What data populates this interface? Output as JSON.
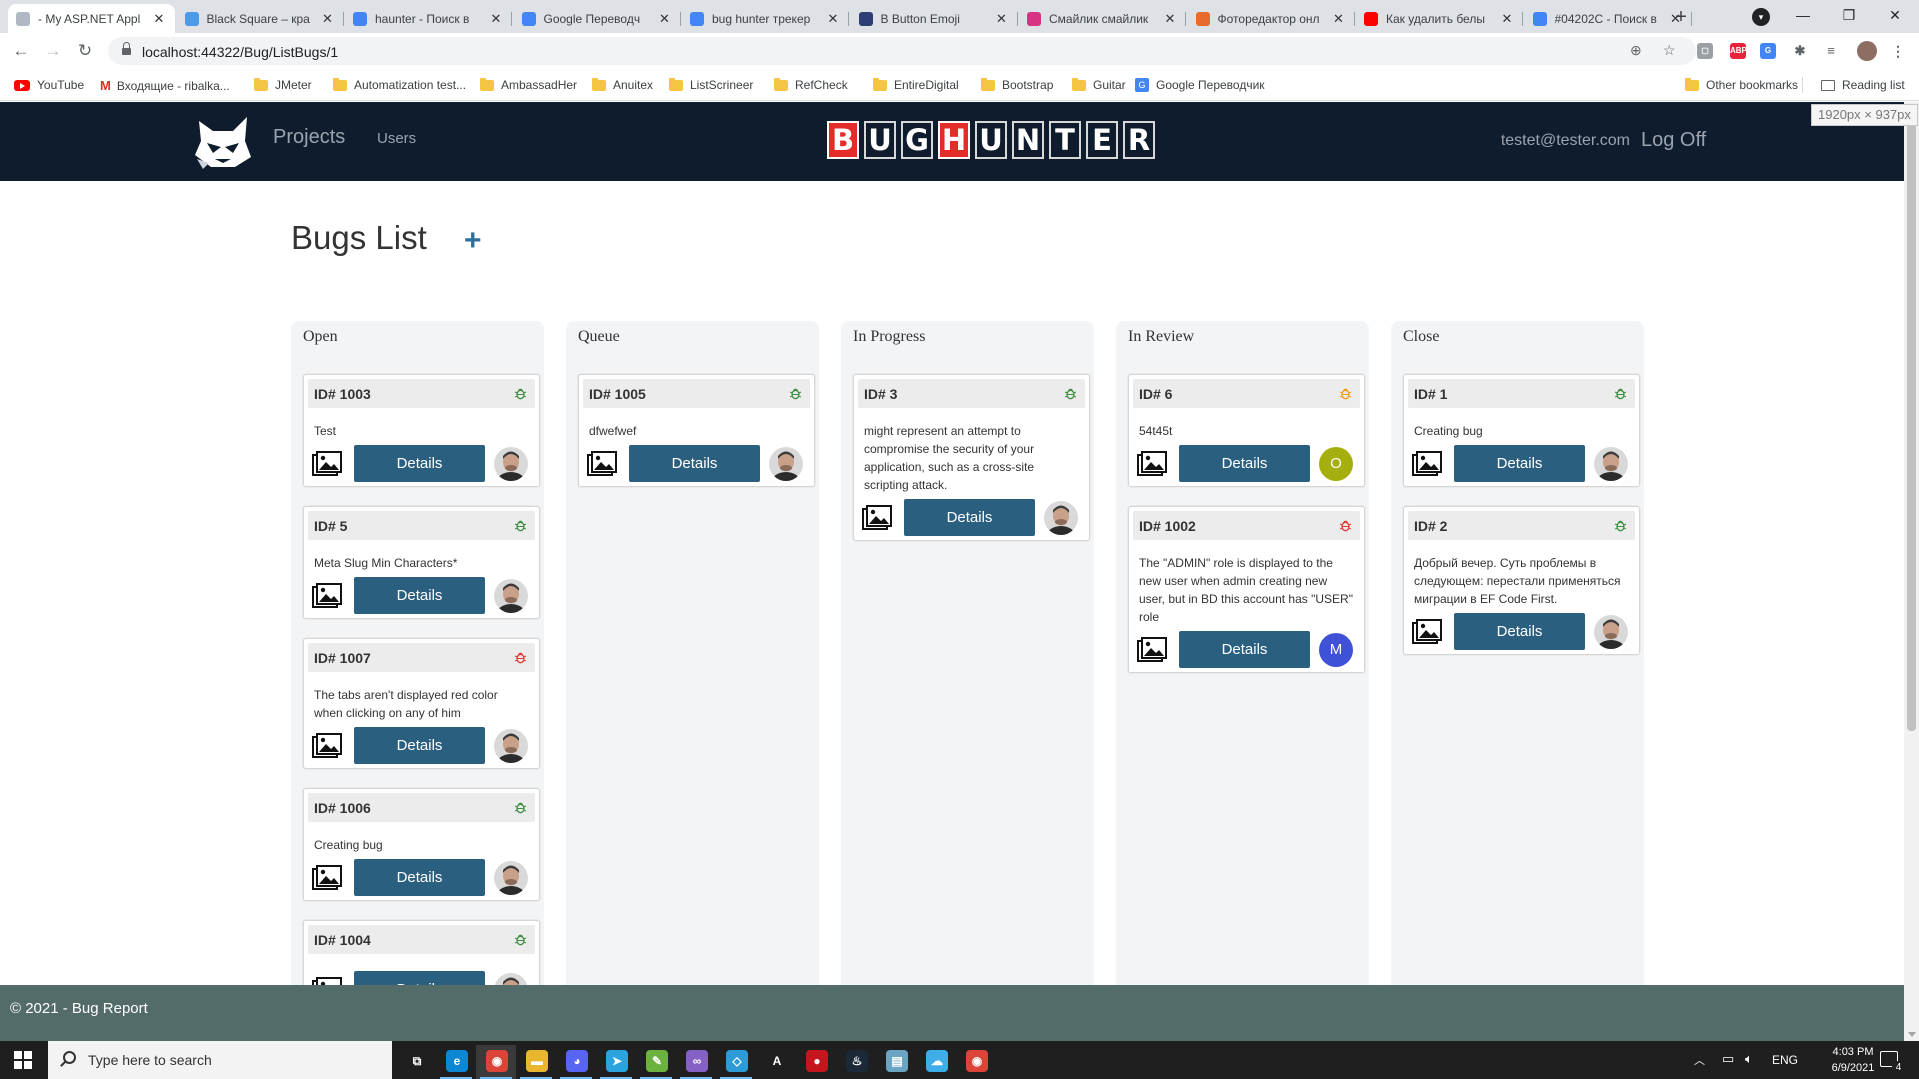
{
  "browser": {
    "tabs": [
      {
        "title": "- My ASP.NET Appl",
        "color": "#b0b8c4",
        "active": true
      },
      {
        "title": "Black Square – кра",
        "color": "#4b9be8",
        "active": false
      },
      {
        "title": "haunter - Поиск в",
        "color": "#4285f4",
        "active": false
      },
      {
        "title": "Google Переводч",
        "color": "#4285f4",
        "active": false
      },
      {
        "title": "bug hunter трекер",
        "color": "#4285f4",
        "active": false
      },
      {
        "title": "B Button Emoji",
        "color": "#2c3e75",
        "active": false
      },
      {
        "title": "Смайлик смайлик",
        "color": "#d63384",
        "active": false
      },
      {
        "title": "Фоторедактор онл",
        "color": "#e86a2c",
        "active": false
      },
      {
        "title": "Как удалить белы",
        "color": "#ff0000",
        "active": false
      },
      {
        "title": "#04202C - Поиск в",
        "color": "#4285f4",
        "active": false
      }
    ],
    "url": "localhost:44322/Bug/ListBugs/1",
    "bookmarks": [
      {
        "label": "YouTube",
        "icon": "youtube-icon"
      },
      {
        "label": "Входящие - ribalka...",
        "icon": "gmail-icon"
      },
      {
        "label": "JMeter",
        "icon": "folder-icon"
      },
      {
        "label": "Automatization test...",
        "icon": "folder-icon"
      },
      {
        "label": "AmbassadHer",
        "icon": "folder-icon"
      },
      {
        "label": "Anuitex",
        "icon": "folder-icon"
      },
      {
        "label": "ListScrineer",
        "icon": "folder-icon"
      },
      {
        "label": "RefCheck",
        "icon": "folder-icon"
      },
      {
        "label": "EntireDigital",
        "icon": "folder-icon"
      },
      {
        "label": "Bootstrap",
        "icon": "folder-icon"
      },
      {
        "label": "Guitar",
        "icon": "folder-icon"
      },
      {
        "label": "Google Переводчик",
        "icon": "translate-icon"
      }
    ],
    "other_bookmarks": "Other bookmarks",
    "reading_list": "Reading list",
    "viewport_tip": "1920px × 937px"
  },
  "navbar": {
    "projects": "Projects",
    "users": "Users",
    "brand_letters": [
      "B",
      "U",
      "G",
      "H",
      "U",
      "N",
      "T",
      "E",
      "R"
    ],
    "user_email": "testet@tester.com",
    "logoff": "Log Off"
  },
  "page": {
    "title": "Bugs List",
    "add_symbol": "+"
  },
  "columns": [
    {
      "name": "Open",
      "cards": [
        {
          "id": "ID# 1003",
          "desc": "Test",
          "priority": "green",
          "avatar": "photo"
        },
        {
          "id": "ID# 5",
          "desc": "Meta Slug Min Characters*",
          "priority": "green",
          "avatar": "photo"
        },
        {
          "id": "ID# 1007",
          "desc": "The tabs aren't displayed red color when clicking on any of him",
          "priority": "red",
          "avatar": "photo"
        },
        {
          "id": "ID# 1006",
          "desc": "Creating bug",
          "priority": "green",
          "avatar": "photo"
        },
        {
          "id": "ID# 1004",
          "desc": "",
          "priority": "green",
          "avatar": "photo"
        }
      ]
    },
    {
      "name": "Queue",
      "cards": [
        {
          "id": "ID# 1005",
          "desc": "dfwefwef",
          "priority": "green",
          "avatar": "photo"
        }
      ]
    },
    {
      "name": "In Progress",
      "cards": [
        {
          "id": "ID# 3",
          "desc": "might represent an attempt to compromise the security of your application, such as a cross-site scripting attack.",
          "priority": "green",
          "avatar": "photo"
        }
      ]
    },
    {
      "name": "In Review",
      "cards": [
        {
          "id": "ID# 6",
          "desc": "54t45t",
          "priority": "orange",
          "avatar": "O",
          "avatar_color": "#a5b00e"
        },
        {
          "id": "ID# 1002",
          "desc": "The \"ADMIN\" role is displayed to the new user when admin creating new user, but in BD this account has \"USER\" role",
          "priority": "red",
          "avatar": "M",
          "avatar_color": "#3f51d6"
        }
      ]
    },
    {
      "name": "Close",
      "cards": [
        {
          "id": "ID# 1",
          "desc": "Creating bug",
          "priority": "green",
          "avatar": "photo"
        },
        {
          "id": "ID# 2",
          "desc": "Добрый вечер. Суть проблемы в следующем: перестали применяться миграции в EF Code First.",
          "priority": "green",
          "avatar": "photo"
        }
      ]
    }
  ],
  "details_label": "Details",
  "priority_colors": {
    "green": "#3e8e41",
    "red": "#e53935",
    "orange": "#f39c12"
  },
  "footer": "© 2021 - Bug Report",
  "taskbar": {
    "search_placeholder": "Type here to search",
    "lang": "ENG",
    "time": "4:03 PM",
    "date": "6/9/2021",
    "notifications": "4"
  }
}
